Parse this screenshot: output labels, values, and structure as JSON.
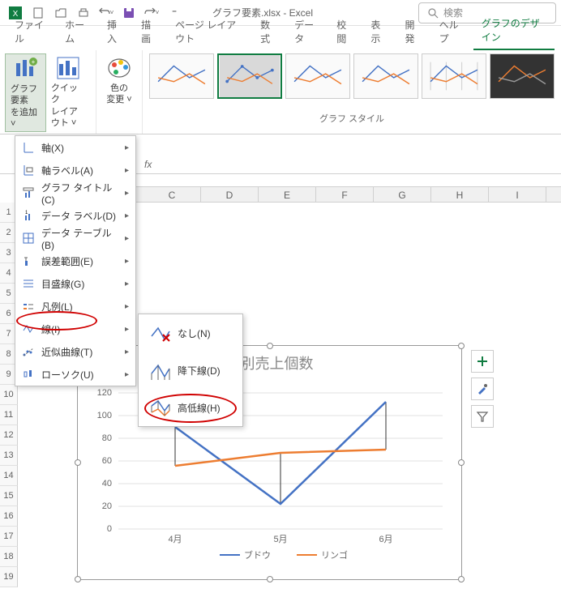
{
  "title": "グラフ要素.xlsx - Excel",
  "search_placeholder": "検索",
  "tabs": {
    "file": "ファイル",
    "home": "ホーム",
    "insert": "挿入",
    "draw": "描画",
    "page_layout": "ページ レイアウト",
    "formulas": "数式",
    "data": "データ",
    "review": "校閲",
    "view": "表示",
    "developer": "開発",
    "help": "ヘルプ",
    "chart_design": "グラフのデザイン"
  },
  "ribbon": {
    "add_element_l1": "グラフ要素",
    "add_element_l2": "を追加 ˅",
    "quick_layout_l1": "クイック",
    "quick_layout_l2": "レイアウト ˅",
    "change_colors_l1": "色の",
    "change_colors_l2": "変更 ˅",
    "styles_label": "グラフ スタイル"
  },
  "menu": {
    "axes": "軸(X)",
    "axis_titles": "軸ラベル(A)",
    "chart_title": "グラフ タイトル(C)",
    "data_labels": "データ ラベル(D)",
    "data_table": "データ テーブル(B)",
    "error_bars": "誤差範囲(E)",
    "gridlines": "目盛線(G)",
    "legend": "凡例(L)",
    "lines": "線(I)",
    "trendline": "近似曲線(T)",
    "updown_bars": "ローソク(U)"
  },
  "submenu": {
    "none": "なし(N)",
    "drop_lines": "降下線(D)",
    "high_low_lines": "高低線(H)"
  },
  "columns": [
    "C",
    "D",
    "E",
    "F",
    "G",
    "H",
    "I"
  ],
  "rows": [
    "1",
    "2",
    "3",
    "4",
    "5",
    "6",
    "7",
    "8",
    "9",
    "10",
    "11",
    "12",
    "13",
    "14",
    "15",
    "16",
    "17",
    "18",
    "19"
  ],
  "chart_data": {
    "type": "line",
    "title": "月別売上個数",
    "categories": [
      "4月",
      "5月",
      "6月"
    ],
    "series": [
      {
        "name": "ブドウ",
        "values": [
          90,
          22,
          112
        ],
        "color": "#4472c4"
      },
      {
        "name": "リンゴ",
        "values": [
          56,
          67,
          70
        ],
        "color": "#ed7d31"
      }
    ],
    "ylim": [
      0,
      120
    ],
    "yticks": [
      0,
      20,
      40,
      60,
      80,
      100,
      120
    ],
    "high_low_lines": true
  }
}
